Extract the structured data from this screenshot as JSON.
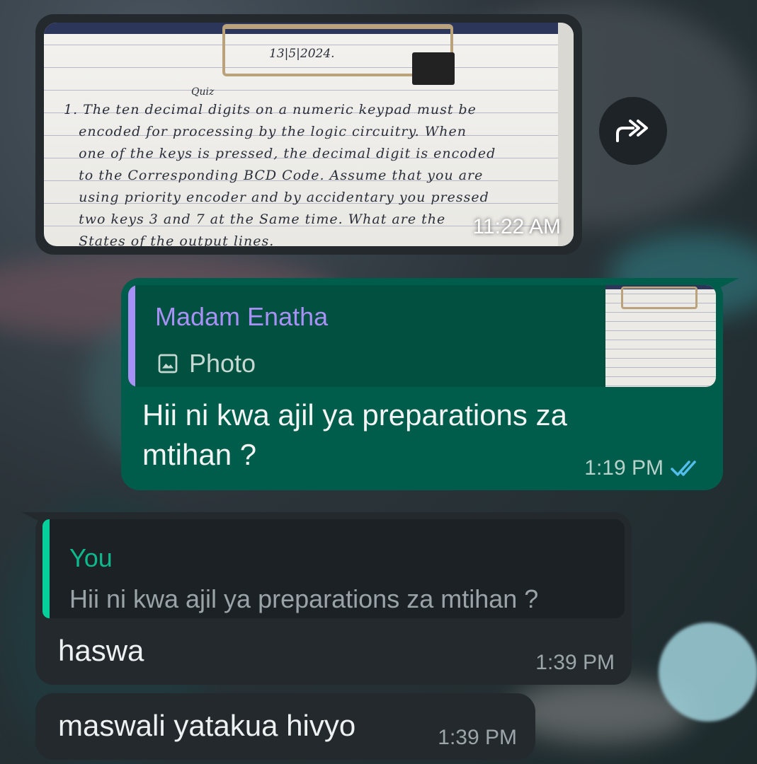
{
  "messages": [
    {
      "type": "image",
      "direction": "incoming",
      "time": "11:22 AM",
      "image_text": {
        "date": "13|5|2024.",
        "title": "Quiz",
        "lines": [
          "1. The ten decimal digits on a numeric keypad must be",
          "   encoded for processing by the logic circuitry. When",
          "   one of the keys is pressed, the decimal digit is encoded",
          "   to the Corresponding BCD Code. Assume that you are",
          "   using priority encoder and by accidentary you pressed",
          "   two keys 3 and 7 at the Same time. What are the",
          "   States of the output lines."
        ]
      }
    },
    {
      "type": "text",
      "direction": "outgoing",
      "quote": {
        "sender": "Madam Enatha",
        "label": "Photo",
        "icon": "photo-icon"
      },
      "text": "Hii ni kwa ajil ya preparations za mtihan ?",
      "time": "1:19 PM",
      "status": "read"
    },
    {
      "type": "text",
      "direction": "incoming",
      "quote": {
        "sender": "You",
        "text": "Hii ni kwa ajil ya preparations za mtihan ?"
      },
      "text": "haswa",
      "time": "1:39 PM"
    },
    {
      "type": "text",
      "direction": "incoming",
      "text": "maswali yatakua hivyo",
      "time": "1:39 PM"
    }
  ],
  "actions": {
    "forward_icon": "forward-icon"
  },
  "colors": {
    "outgoing_bubble": "#005c4b",
    "incoming_bubble": "#23292d",
    "quote_name_outgoing": "#a791f6",
    "quote_name_incoming": "#06cf9c",
    "read_ticks": "#53bdeb"
  }
}
